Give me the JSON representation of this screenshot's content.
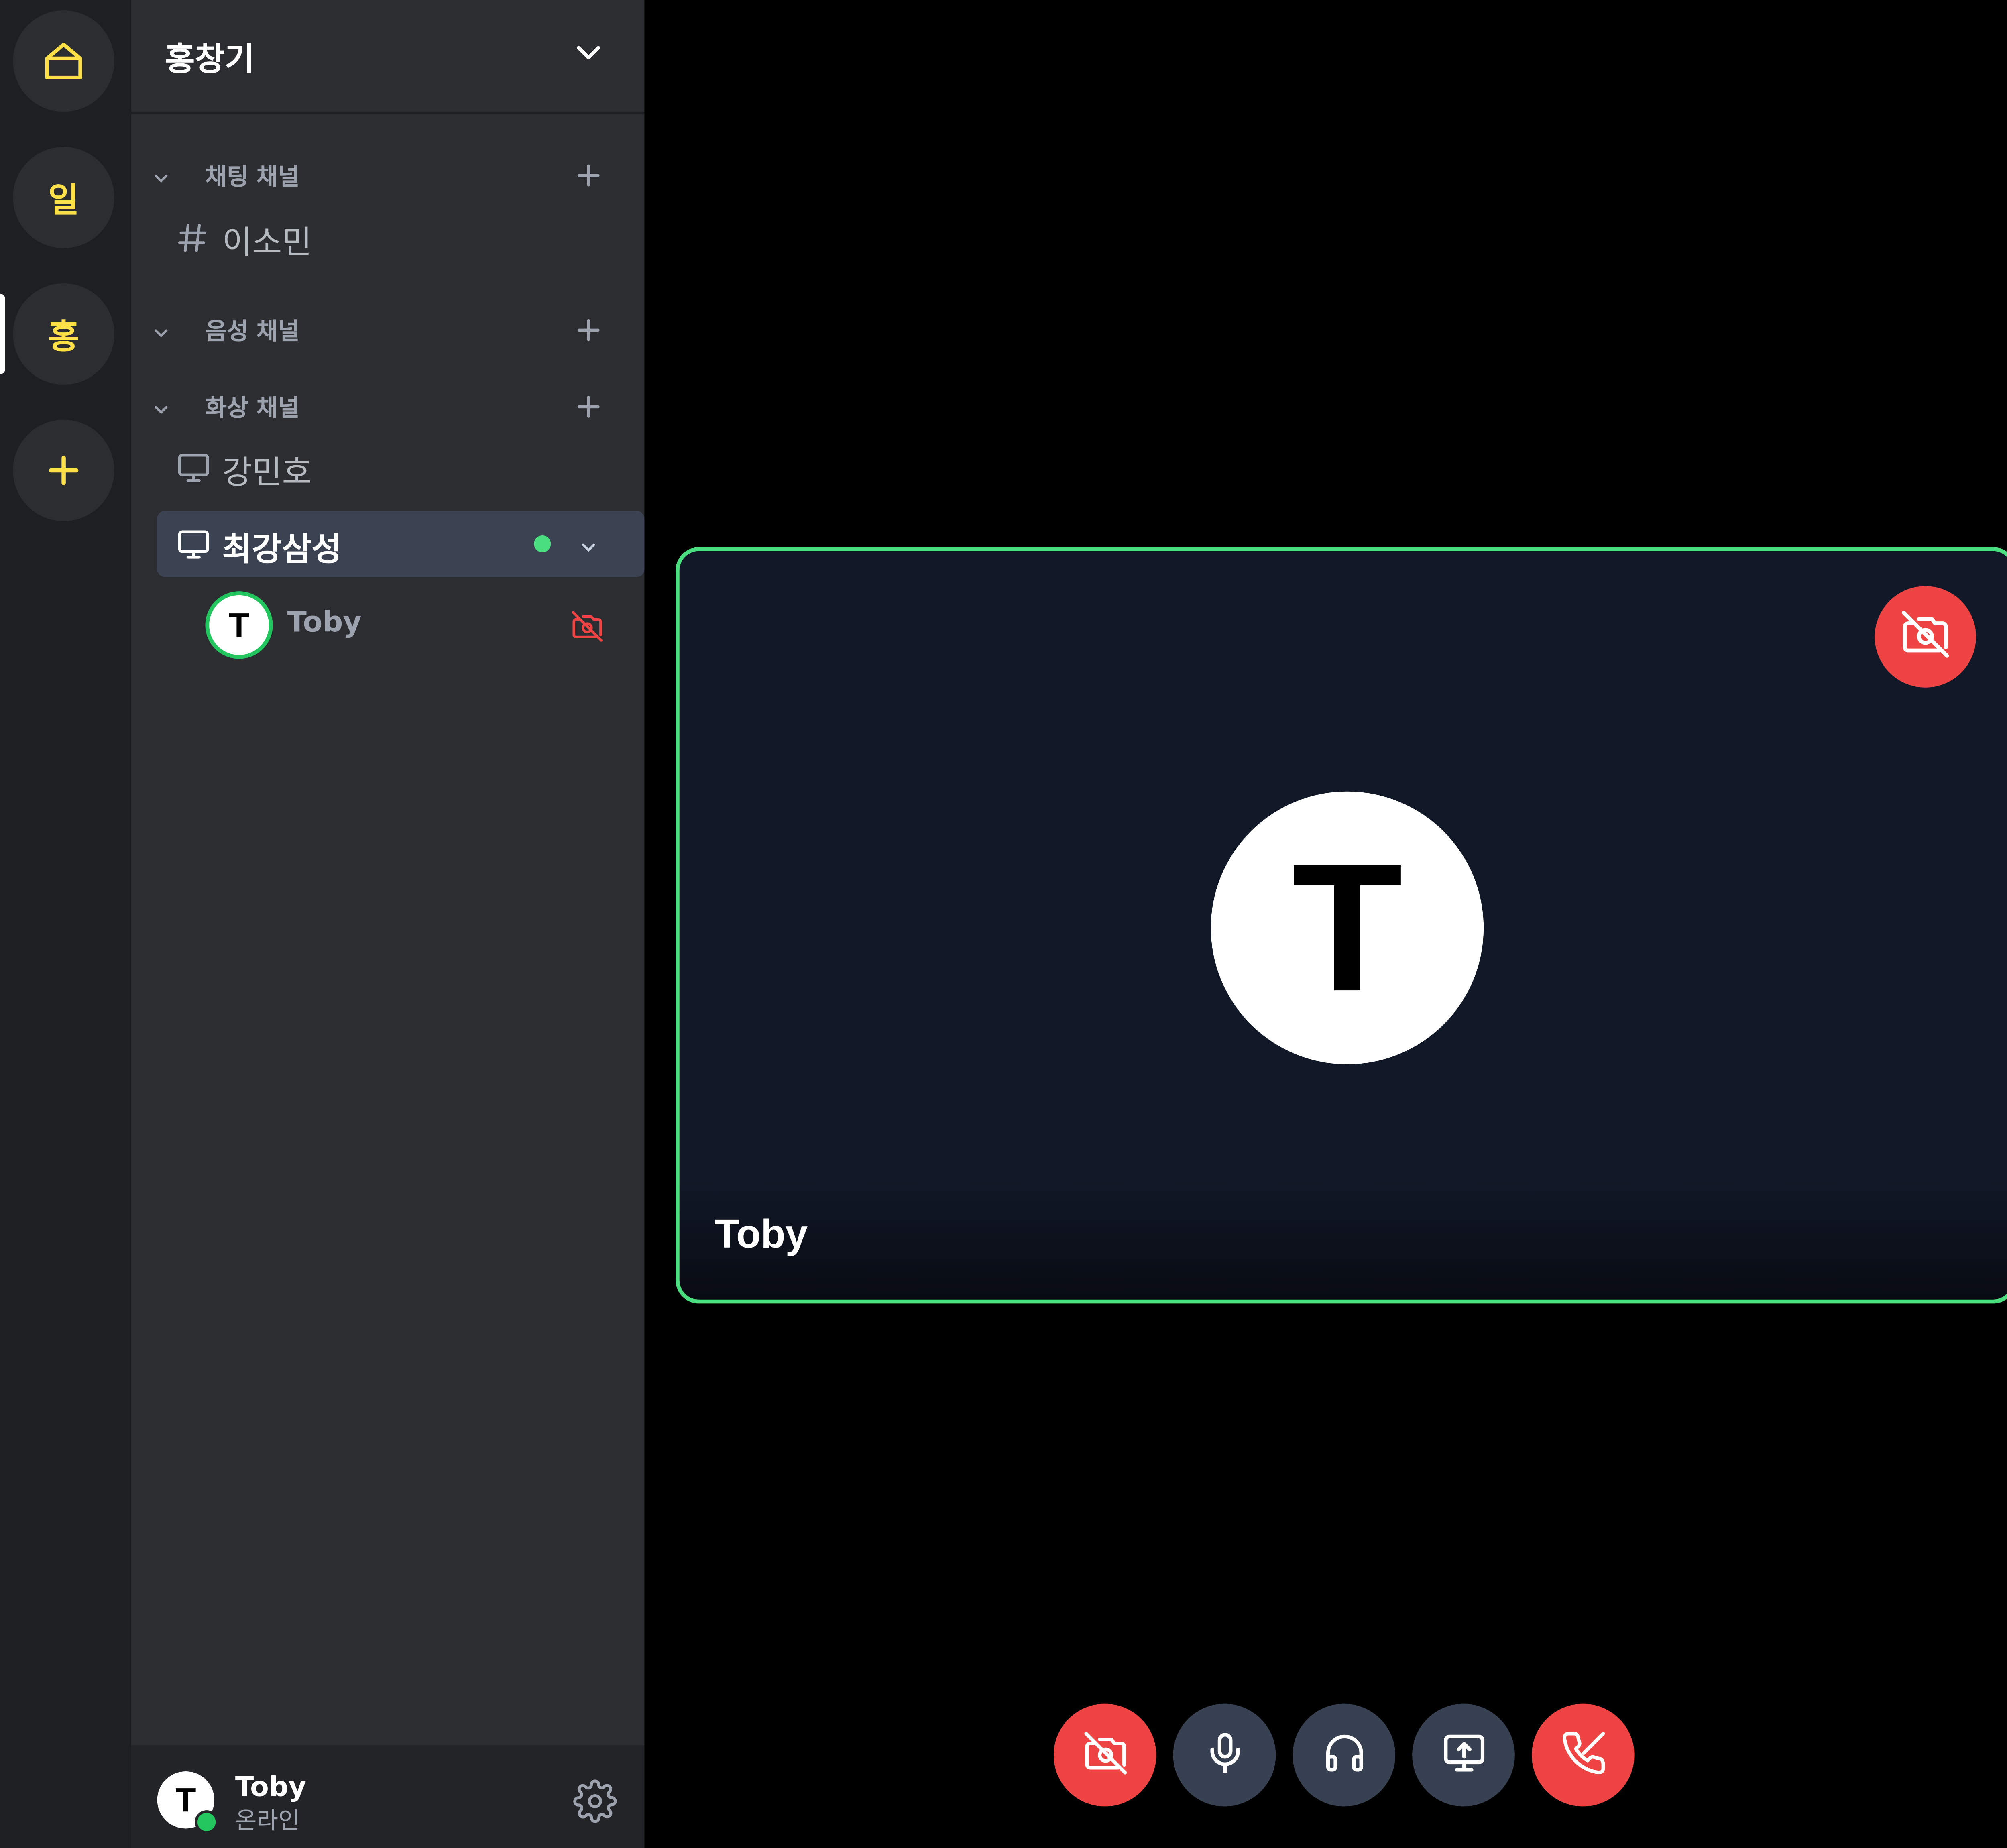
{
  "rail": {
    "home_icon": "home-icon",
    "servers": [
      {
        "label": "일"
      },
      {
        "label": "홍"
      }
    ],
    "add_icon": "plus-icon"
  },
  "server": {
    "name": "홍창기",
    "categories": {
      "chat": {
        "label": "채팅 채널",
        "channels": [
          {
            "name": "이소민"
          }
        ]
      },
      "voice": {
        "label": "음성 채널"
      },
      "video": {
        "label": "화상 채널",
        "channels": [
          {
            "name": "강민호"
          },
          {
            "name": "최강삼성"
          }
        ]
      }
    },
    "members": [
      {
        "initial": "T",
        "name": "Toby",
        "camera": "camera-off"
      }
    ]
  },
  "user_panel": {
    "initial": "T",
    "name": "Toby",
    "status": "온라인"
  },
  "tile": {
    "initial": "T",
    "name": "Toby"
  },
  "controls": [
    "camera-off-icon",
    "microphone-icon",
    "headphones-icon",
    "screen-share-icon",
    "hang-up-icon"
  ],
  "colors": {
    "accent_yellow": "#fde047",
    "speaking_green": "#4ade80",
    "danger_red": "#ef4444",
    "control_gray": "#374151"
  }
}
